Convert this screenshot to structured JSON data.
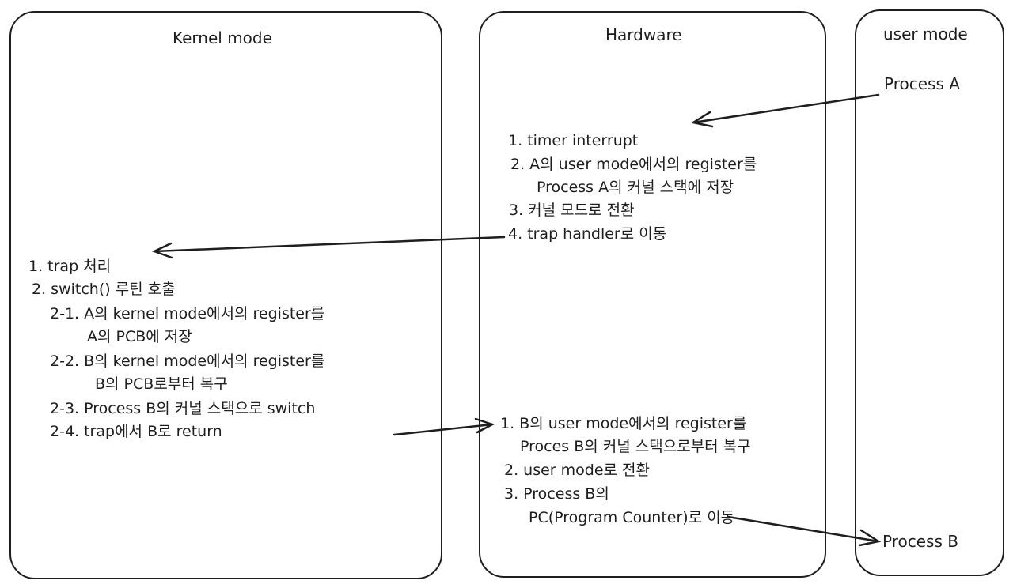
{
  "kernel": {
    "title": "Kernel mode",
    "lines": [
      "1. trap 처리",
      "2. switch() 루틴 호출",
      "2-1. A의 kernel mode에서의 register를",
      "A의 PCB에 저장",
      "2-2. B의 kernel mode에서의 register를",
      "B의 PCB로부터 복구",
      "2-3. Process B의 커널 스택으로 switch",
      "2-4. trap에서 B로 return"
    ]
  },
  "hardware": {
    "title": "Hardware",
    "top_lines": [
      "1. timer interrupt",
      "2. A의 user mode에서의 register를",
      "Process A의 커널 스택에 저장",
      "3. 커널 모드로 전환",
      "4. trap handler로 이동"
    ],
    "bottom_lines": [
      "1. B의 user mode에서의 register를",
      "Proces B의 커널 스택으로부터 복구",
      "2. user mode로 전환",
      "3. Process B의",
      "PC(Program Counter)로 이동"
    ]
  },
  "user": {
    "title": "user mode",
    "process_a": "Process A",
    "process_b": "Process B"
  },
  "colors": {
    "stroke": "#1e1e1e",
    "background": "#ffffff"
  }
}
